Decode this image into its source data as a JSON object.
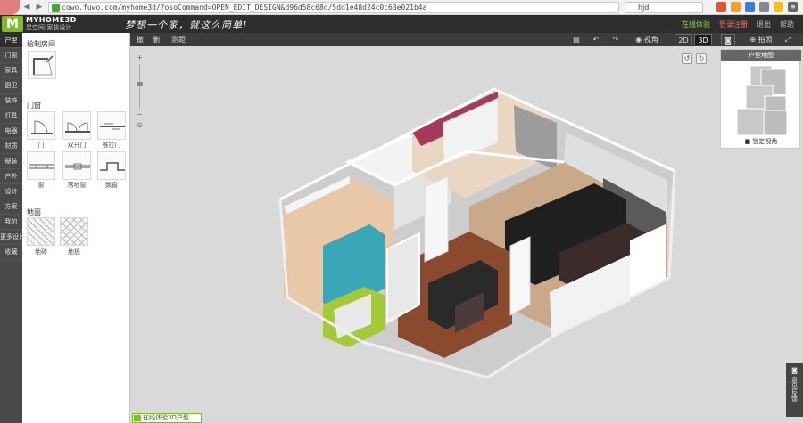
{
  "browser": {
    "url": "cowo.fuwo.com/myhome3d/?osoCommand=OPEN_EDIT_DESIGN&d96d58c68d/5dd1e48d24c0c63e021b4a",
    "search_value": "hjd",
    "back_glyph": "◀",
    "forward_glyph": "▶",
    "menu_glyph": "≡"
  },
  "header": {
    "brand": "MYHOME3D",
    "brand_sub": "星空间|家装设计",
    "slogan": "梦想一个家，就这么简单!",
    "links": [
      "在线体验",
      "登录注册",
      "退出",
      "帮助"
    ]
  },
  "left_nav": {
    "items": [
      "户型",
      "门窗",
      "家具",
      "厨卫",
      "装饰",
      "灯具",
      "电器",
      "材质",
      "硬装",
      "户外",
      "设计",
      "方案",
      "我的",
      "更多设计",
      "收藏"
    ]
  },
  "panel": {
    "section_draw": "绘制房间",
    "section_doors": "门窗",
    "section_floor": "地面",
    "doors": [
      "门",
      "双开门",
      "推拉门",
      "窗",
      "落地窗",
      "飘窗"
    ],
    "floor": [
      "地砖",
      "地板"
    ]
  },
  "toolbar": {
    "left_buttons": [
      "撤",
      "删",
      "测距"
    ],
    "view_label": "视角",
    "mode_2d": "2D",
    "mode_3d": "3D",
    "right_labels": [
      "拍照",
      "全屏"
    ]
  },
  "canvas": {
    "zoom_plus": "+",
    "zoom_minus": "−",
    "zoom_reset": "⊙",
    "rotate_left": "↺",
    "rotate_right": "↻"
  },
  "minimap": {
    "title": "户型地图",
    "lock_label": "锁定视角"
  },
  "footer": {
    "badge": "在线体验3D户型",
    "feedback": "意见反馈"
  }
}
